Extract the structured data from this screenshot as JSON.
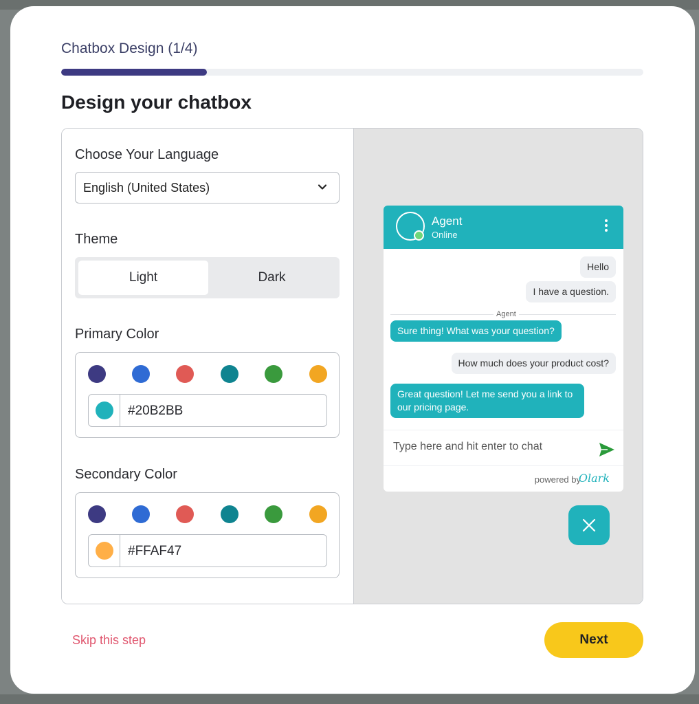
{
  "wizard": {
    "step_label": "Chatbox Design (1/4)",
    "progress": 0.25,
    "title": "Design your chatbox"
  },
  "language": {
    "label": "Choose Your Language",
    "selected": "English (United States)"
  },
  "theme": {
    "label": "Theme",
    "options": [
      "Light",
      "Dark"
    ],
    "selected": "Light"
  },
  "primary_color": {
    "label": "Primary Color",
    "swatches": [
      "#3d3a82",
      "#2f6bd4",
      "#e05a55",
      "#0f8490",
      "#3a9a3d",
      "#f2a622"
    ],
    "value": "#20B2BB",
    "value_color": "#20b2bb"
  },
  "secondary_color": {
    "label": "Secondary Color",
    "swatches": [
      "#3d3a82",
      "#2f6bd4",
      "#e05a55",
      "#0f8490",
      "#3a9a3d",
      "#f2a622"
    ],
    "value": "#FFAF47",
    "value_color": "#ffaf47"
  },
  "preview": {
    "agent_name": "Agent",
    "agent_status": "Online",
    "messages": [
      {
        "from": "user",
        "text": "Hello"
      },
      {
        "from": "user",
        "text": "I have a question."
      },
      {
        "from": "agent",
        "text": "Sure thing! What was your question?"
      },
      {
        "from": "user",
        "text": "How much does your product cost?"
      },
      {
        "from": "agent",
        "text": "Great question! Let me send you a link to our pricing page."
      }
    ],
    "agent_divider": "Agent",
    "input_placeholder": "Type here and hit enter to chat",
    "powered_by": "powered by",
    "powered_logo": "Olark"
  },
  "footer": {
    "skip_label": "Skip this step",
    "next_label": "Next"
  },
  "colors": {
    "accent": "#20b2bb",
    "next_button": "#f8c81b",
    "skip_link": "#e0566e",
    "progress": "#3d3a82"
  },
  "icons": [
    "chevron-down-icon",
    "kebab-menu-icon",
    "send-icon",
    "close-icon"
  ]
}
